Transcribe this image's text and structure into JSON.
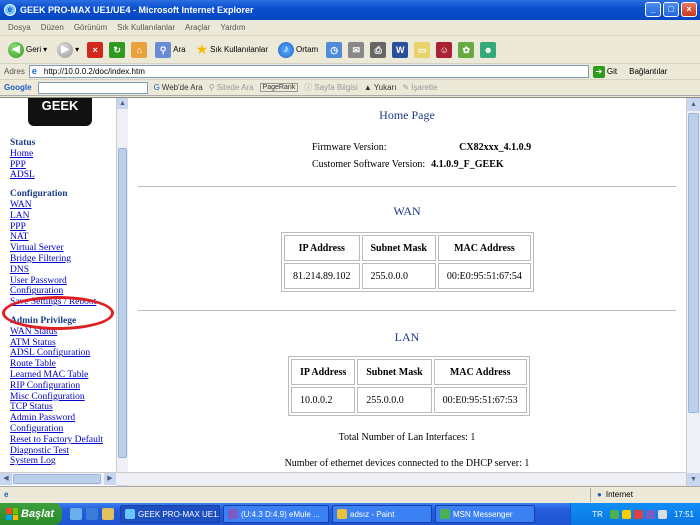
{
  "window": {
    "title": "GEEK PRO-MAX UE1/UE4 - Microsoft Internet Explorer"
  },
  "menu": [
    "Dosya",
    "Düzen",
    "Görünüm",
    "Sık Kullanılanlar",
    "Araçlar",
    "Yardım"
  ],
  "toolbar": {
    "back": "Geri",
    "search": "Ara",
    "favorites": "Sık Kullanılanlar",
    "media": "Ortam"
  },
  "address": {
    "label": "Adres",
    "url": "http://10.0.0.2/doc/index.htm",
    "go": "Git",
    "links": "Bağlantılar"
  },
  "google": {
    "brand": "Google",
    "search_web": "Web'de Ara",
    "search_site": "Sitede Ara",
    "pagerank": "PageRank",
    "page_info": "Sayfa Bilgisi",
    "up": "Yukarı",
    "highlight": "İşaretle"
  },
  "sidebar": {
    "logo": "GEEK",
    "status": {
      "header": "Status",
      "items": [
        "Home",
        "PPP",
        "ADSL"
      ]
    },
    "configuration": {
      "header": "Configuration",
      "items": [
        "WAN",
        "LAN",
        "PPP",
        "NAT",
        "Virtual Server",
        "Bridge Filtering",
        "DNS",
        "User Password",
        "Configuration",
        "Save Settings / Reboot"
      ]
    },
    "admin": {
      "header": "Admin Privilege",
      "items": [
        "WAN Status",
        "ATM Status",
        "ADSL Configuration",
        "Route Table",
        "Learned MAC Table",
        "RIP Configuration",
        "Misc Configuration",
        "TCP Status",
        "Admin Password",
        "Configuration",
        "Reset to Factory Default",
        "Diagnostic Test",
        "System Log"
      ]
    }
  },
  "main": {
    "title": "Home Page",
    "firmware_label": "Firmware Version:",
    "firmware_value": "CX82xxx_4.1.0.9",
    "customer_label": "Customer Software Version:",
    "customer_value": "4.1.0.9_F_GEEK",
    "wan": {
      "title": "WAN",
      "headers": [
        "IP Address",
        "Subnet Mask",
        "MAC Address"
      ],
      "row": [
        "81.214.89.102",
        "255.0.0.0",
        "00:E0:95:51:67:54"
      ]
    },
    "lan": {
      "title": "LAN",
      "headers": [
        "IP Address",
        "Subnet Mask",
        "MAC Address"
      ],
      "row": [
        "10.0.0.2",
        "255.0.0.0",
        "00:E0:95:51:67:53"
      ]
    },
    "total_lan": "Total Number of Lan Interfaces: 1",
    "dhcp": "Number of ethernet devices connected to the DHCP server: 1"
  },
  "status": {
    "zone": "Internet"
  },
  "taskbar": {
    "start": "Başlat",
    "tasks": [
      "GEEK PRO-MAX UE1...",
      "(U:4.3 D:4.9) eMule ...",
      "adsız - Paint",
      "MSN Messenger"
    ],
    "lang": "TR",
    "clock": "17:51"
  }
}
